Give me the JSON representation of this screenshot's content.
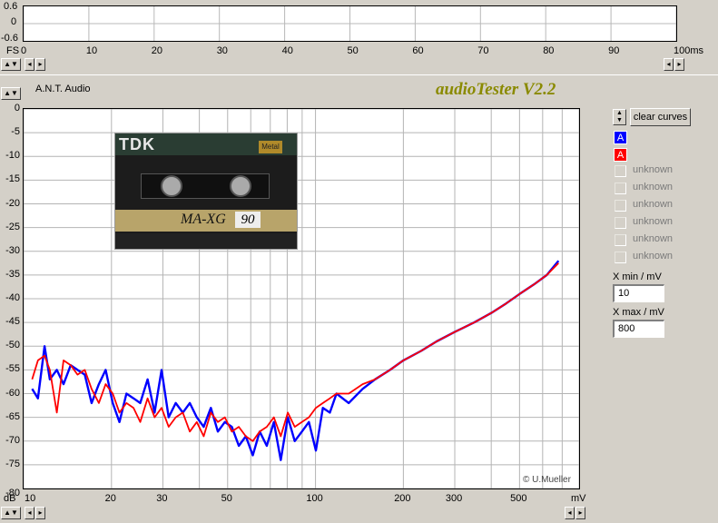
{
  "top_panel": {
    "y_ticks": [
      "0.6",
      "0",
      "-0.6"
    ],
    "x_ticks": [
      "0",
      "10",
      "20",
      "30",
      "40",
      "50",
      "60",
      "70",
      "80",
      "90",
      "100ms"
    ],
    "x_unit_prefix": "FS",
    "x_range": [
      0,
      100
    ]
  },
  "header": {
    "company": "A.N.T. Audio",
    "app_title": "audioTester V2.2"
  },
  "controls": {
    "clear_label": "clear curves",
    "curve_a_label": "A",
    "curve_b_label": "A",
    "curve_a_color": "#0000ff",
    "curve_b_color": "#ff0000",
    "unknown_labels": [
      "unknown",
      "unknown",
      "unknown",
      "unknown",
      "unknown",
      "unknown"
    ],
    "xmin_label": "X min / mV",
    "xmin_value": "10",
    "xmax_label": "X max / mV",
    "xmax_value": "800"
  },
  "cassette": {
    "brand": "TDK",
    "model": "MA-XG",
    "length": "90",
    "tag": "Metal"
  },
  "chart_data": {
    "type": "line",
    "xscale": "log",
    "xlim": [
      10,
      800
    ],
    "ylim": [
      -80,
      0
    ],
    "y_ticks": [
      "0",
      "-5",
      "-10",
      "-15",
      "-20",
      "-25",
      "-30",
      "-35",
      "-40",
      "-45",
      "-50",
      "-55",
      "-60",
      "-65",
      "-70",
      "-75",
      "-80"
    ],
    "y_unit": "dB",
    "x_ticks": [
      "10",
      "20",
      "30",
      "50",
      "100",
      "200",
      "300",
      "500"
    ],
    "x_unit": "mV",
    "copyright": "© U.Mueller",
    "grid": true,
    "series": [
      {
        "color": "#0000ff",
        "x": [
          10.7,
          11.2,
          11.8,
          12.3,
          13.0,
          13.7,
          14.5,
          15.3,
          16.2,
          17.1,
          18.1,
          19.1,
          20.2,
          21.3,
          22.5,
          23.8,
          25.1,
          26.6,
          28.1,
          29.7,
          31.4,
          33.2,
          35.1,
          37.1,
          39.2,
          41.4,
          43.8,
          46.3,
          48.9,
          51.7,
          54.6,
          57.7,
          61.0,
          64.4,
          68.1,
          72.0,
          76.0,
          80.4,
          84.9,
          89.8,
          94.9,
          100.3,
          106.0,
          112.0,
          118.0,
          130.0,
          145.0,
          160.0,
          180.0,
          200.0,
          230.0,
          260.0,
          300.0,
          350.0,
          400.0,
          450.0,
          500.0,
          560.0,
          620.0,
          680.0
        ],
        "y": [
          -59,
          -61,
          -50,
          -57,
          -55,
          -58,
          -54,
          -55,
          -56,
          -62,
          -58,
          -55,
          -62,
          -66,
          -60,
          -61,
          -62,
          -57,
          -64,
          -55,
          -65,
          -62,
          -64,
          -62,
          -65,
          -67,
          -63,
          -68,
          -66,
          -67,
          -71,
          -69,
          -73,
          -68,
          -71,
          -66,
          -74,
          -65,
          -70,
          -68,
          -66,
          -72,
          -63,
          -64,
          -60,
          -62,
          -59,
          -57,
          -55,
          -53,
          -51,
          -49,
          -47,
          -45,
          -43,
          -41,
          -39,
          -37,
          -35,
          -32
        ]
      },
      {
        "color": "#ff0000",
        "x": [
          10.7,
          11.2,
          11.8,
          12.3,
          13.0,
          13.7,
          14.5,
          15.3,
          16.2,
          17.1,
          18.1,
          19.1,
          20.2,
          21.3,
          22.5,
          23.8,
          25.1,
          26.6,
          28.1,
          29.7,
          31.4,
          33.2,
          35.1,
          37.1,
          39.2,
          41.4,
          43.8,
          46.3,
          48.9,
          51.7,
          54.6,
          57.7,
          61.0,
          64.4,
          68.1,
          72.0,
          76.0,
          80.4,
          84.9,
          89.8,
          94.9,
          100.3,
          106.0,
          112.0,
          118.0,
          130.0,
          145.0,
          160.0,
          180.0,
          200.0,
          230.0,
          260.0,
          300.0,
          350.0,
          400.0,
          450.0,
          500.0,
          560.0,
          620.0,
          680.0
        ],
        "y": [
          -57,
          -53,
          -52,
          -55,
          -64,
          -53,
          -54,
          -56,
          -55,
          -59,
          -62,
          -58,
          -60,
          -64,
          -62,
          -63,
          -66,
          -61,
          -65,
          -63,
          -67,
          -65,
          -64,
          -68,
          -66,
          -69,
          -64,
          -66,
          -65,
          -68,
          -67,
          -69,
          -70,
          -68,
          -67,
          -65,
          -69,
          -64,
          -67,
          -66,
          -65,
          -63,
          -62,
          -61,
          -60,
          -60,
          -58,
          -57,
          -55,
          -53,
          -51,
          -49,
          -47,
          -45,
          -43,
          -41,
          -39,
          -37,
          -35,
          -32.5
        ]
      }
    ]
  }
}
